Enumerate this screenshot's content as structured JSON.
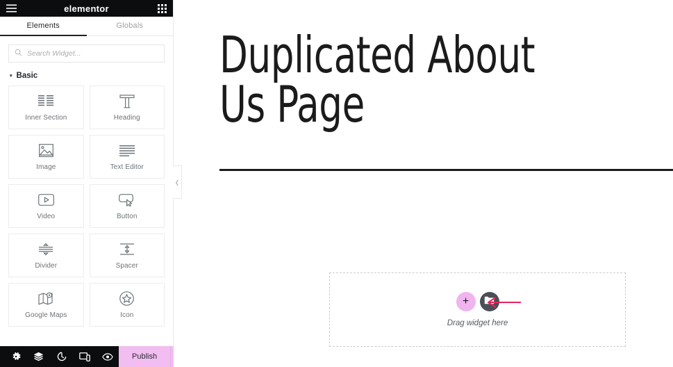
{
  "panel": {
    "logo_text": "elementor",
    "menu_icon": "hamburger-icon",
    "apps_icon": "grid-apps-icon",
    "tabs": [
      {
        "label": "Elements",
        "active": true
      },
      {
        "label": "Globals",
        "active": false
      }
    ],
    "search": {
      "placeholder": "Search Widget...",
      "value": "",
      "icon": "search-icon"
    },
    "category": {
      "label": "Basic",
      "caret": "▾",
      "expanded": true
    },
    "widgets": [
      {
        "label": "Inner Section",
        "icon": "inner-section-icon"
      },
      {
        "label": "Heading",
        "icon": "heading-icon"
      },
      {
        "label": "Image",
        "icon": "image-icon"
      },
      {
        "label": "Text Editor",
        "icon": "text-editor-icon"
      },
      {
        "label": "Video",
        "icon": "video-icon"
      },
      {
        "label": "Button",
        "icon": "button-icon"
      },
      {
        "label": "Divider",
        "icon": "divider-icon"
      },
      {
        "label": "Spacer",
        "icon": "spacer-icon"
      },
      {
        "label": "Google Maps",
        "icon": "google-maps-icon"
      },
      {
        "label": "Icon",
        "icon": "star-icon"
      }
    ],
    "collapse_handle": {
      "icon": "chevron-left-icon",
      "glyph": "❮"
    },
    "footer": {
      "tools": [
        {
          "name": "settings-icon",
          "title": "Settings"
        },
        {
          "name": "navigator-layers-icon",
          "title": "Navigator"
        },
        {
          "name": "history-icon",
          "title": "History"
        },
        {
          "name": "responsive-mode-icon",
          "title": "Responsive Mode"
        },
        {
          "name": "preview-eye-icon",
          "title": "Preview Changes"
        }
      ],
      "publish_label": "Publish",
      "publish_caret": "∧"
    }
  },
  "canvas": {
    "heading": "Duplicated About Us Page",
    "divider": true,
    "drop_zone": {
      "add_button_glyph": "+",
      "add_button_icon": "plus-icon",
      "template_button_icon": "folder-icon",
      "label": "Drag widget here",
      "annotation_icon": "arrow-left-annotation"
    }
  },
  "colors": {
    "panel_header_bg": "#0c0d0e",
    "publish_bg": "#f2bdf0",
    "add_circle_bg": "#f0b4ef",
    "template_circle_bg": "#4a4f57",
    "annotation_arrow": "#e8225a",
    "tab_active_underline": "#1f2124",
    "tile_border": "#e9ecef"
  }
}
